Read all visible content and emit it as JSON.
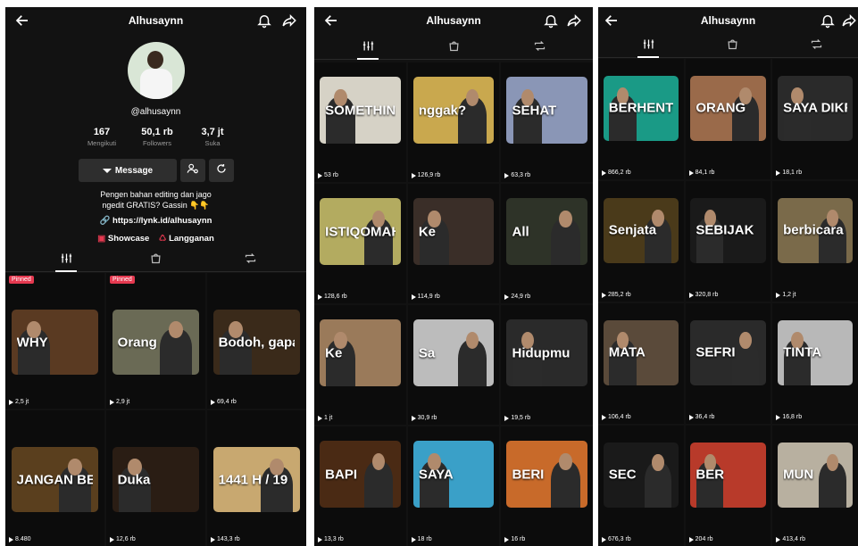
{
  "profile": {
    "title": "Alhusaynn",
    "username": "@alhusaynn",
    "stats": [
      {
        "value": "167",
        "label": "Mengikuti"
      },
      {
        "value": "50,1 rb",
        "label": "Followers"
      },
      {
        "value": "3,7 jt",
        "label": "Suka"
      }
    ],
    "message_label": "Message",
    "bio_line1": "Pengen bahan editing dan jago",
    "bio_line2": "ngedit GRATIS? Gassin 👇👇",
    "link": "https://lynk.id/alhusaynn",
    "showcase_label": "Showcase",
    "subscription_label": "Langganan",
    "pinned_label": "Pinned"
  },
  "colors": {
    "bg": "#121212",
    "accent_red": "#e53950",
    "muted": "#9a9a9a"
  },
  "panel1_videos": [
    {
      "views": "2,5 jt",
      "caption": "WHY",
      "pinned": true,
      "bg": "#5a3a22"
    },
    {
      "views": "2,9 jt",
      "caption": "Orang",
      "pinned": true,
      "bg": "#6a6a55"
    },
    {
      "views": "69,4 rb",
      "caption": "Bodoh, gapapa",
      "pinned": false,
      "bg": "#3a2a1a"
    },
    {
      "views": "8.480",
      "caption": "JANGAN BERDUKA CITA KETIKA",
      "pinned": false,
      "bg": "#5a3f1e"
    },
    {
      "views": "12,6 rb",
      "caption": "Duka",
      "pinned": false,
      "bg": "#2a1d14"
    },
    {
      "views": "143,3 rb",
      "caption": "1441 H / 19",
      "pinned": false,
      "bg": "#c8a870"
    }
  ],
  "panel2_videos": [
    {
      "views": "53 rb",
      "caption": "SOMETHING",
      "bg": "#d6d2c6"
    },
    {
      "views": "126,9 rb",
      "caption": "nggak?",
      "bg": "#c9a84e"
    },
    {
      "views": "63,3 rb",
      "caption": "SEHAT",
      "bg": "#8a96b6"
    },
    {
      "views": "128,6 rb",
      "caption": "ISTIQOMAH",
      "bg": "#b3ab60"
    },
    {
      "views": "114,9 rb",
      "caption": "Ke",
      "bg": "#3a2e28"
    },
    {
      "views": "24,9 rb",
      "caption": "All",
      "bg": "#2e3328"
    },
    {
      "views": "1 jt",
      "caption": "Ke",
      "bg": "#9a7a5a"
    },
    {
      "views": "30,9 rb",
      "caption": "Sa",
      "bg": "#bcbcbc"
    },
    {
      "views": "19,5 rb",
      "caption": "Hidupmu",
      "bg": "#2a2a2a"
    },
    {
      "views": "13,3 rb",
      "caption": "BAPI",
      "bg": "#4a2a14"
    },
    {
      "views": "18 rb",
      "caption": "SAYA",
      "bg": "#3aa0c8"
    },
    {
      "views": "16 rb",
      "caption": "BERI",
      "bg": "#c86a2a"
    }
  ],
  "panel3_videos": [
    {
      "views": "866,2 rb",
      "caption": "BERHENTILAH",
      "bg": "#1a9a86"
    },
    {
      "views": "84,1 rb",
      "caption": "ORANG",
      "bg": "#9a6a4a"
    },
    {
      "views": "18,1 rb",
      "caption": "SAYA DIKRITIK",
      "bg": "#2a2a2a"
    },
    {
      "views": "285,2 rb",
      "caption": "Senjata",
      "bg": "#4a3a1a"
    },
    {
      "views": "320,8 rb",
      "caption": "SEBIJAK",
      "bg": "#1a1a1a"
    },
    {
      "views": "1,2 jt",
      "caption": "berbicara",
      "bg": "#7a6a4a"
    },
    {
      "views": "106,4 rb",
      "caption": "MATA",
      "bg": "#5a4a3a"
    },
    {
      "views": "36,4 rb",
      "caption": "SEFRI",
      "bg": "#2a2a2a"
    },
    {
      "views": "16,8 rb",
      "caption": "TINTA",
      "bg": "#b8b8b8"
    },
    {
      "views": "676,3 rb",
      "caption": "SEC",
      "bg": "#1a1a1a"
    },
    {
      "views": "204 rb",
      "caption": "BER",
      "bg": "#b83a2a"
    },
    {
      "views": "413,4 rb",
      "caption": "MUN",
      "bg": "#b8b0a0"
    }
  ]
}
